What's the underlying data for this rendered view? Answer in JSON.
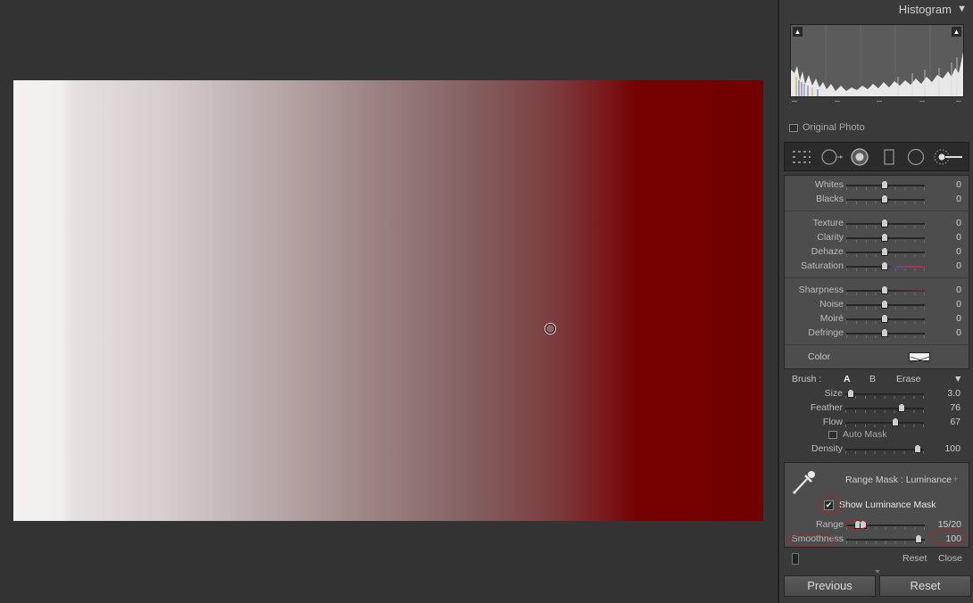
{
  "histogram": {
    "title": "Histogram",
    "toggle_icon": "triangle-down-icon",
    "original_photo_label": "Original Photo"
  },
  "tool_strip": {
    "icons": [
      "grid-overlay-icon",
      "crop-icon",
      "spot-removal-icon",
      "graduated-filter-icon",
      "radial-filter-icon",
      "adjustment-brush-icon"
    ]
  },
  "sliders": [
    {
      "label": "Whites",
      "value": "0",
      "level": 0.5
    },
    {
      "label": "Blacks",
      "value": "0",
      "level": 0.5
    },
    {
      "label": "Texture",
      "value": "0",
      "level": 0.5
    },
    {
      "label": "Clarity",
      "value": "0",
      "level": 0.5
    },
    {
      "label": "Dehaze",
      "value": "0",
      "level": 0.5
    },
    {
      "label": "Saturation",
      "value": "0",
      "level": 0.5
    },
    {
      "label": "Sharpness",
      "value": "0",
      "level": 0.5
    },
    {
      "label": "Noise",
      "value": "0",
      "level": 0.5
    },
    {
      "label": "Moiré",
      "value": "0",
      "level": 0.5
    },
    {
      "label": "Defringe",
      "value": "0",
      "level": 0.5
    }
  ],
  "color": {
    "label": "Color"
  },
  "brush": {
    "label": "Brush :",
    "a": "A",
    "b": "B",
    "erase": "Erase",
    "size": {
      "label": "Size",
      "value": "3.0",
      "level": 0.03
    },
    "feather": {
      "label": "Feather",
      "value": "76",
      "level": 0.76
    },
    "flow": {
      "label": "Flow",
      "value": "67",
      "level": 0.67
    },
    "auto_mask": "Auto Mask",
    "density": {
      "label": "Density",
      "value": "100",
      "level": 1.0
    }
  },
  "range_mask": {
    "label": "Range Mask : Luminance",
    "show_mask": "Show Luminance Mask",
    "show_mask_checked": true,
    "range": {
      "label": "Range",
      "value": "15/20"
    },
    "smoothness": {
      "label": "Smoothness",
      "value": "100",
      "level": 1.0
    }
  },
  "footer": {
    "reset": "Reset",
    "close": "Close"
  },
  "buttons": {
    "previous": "Previous",
    "reset": "Reset"
  },
  "colors": {
    "mask_red": "#730000",
    "panel_bg": "#3a3a3a",
    "canvas_bg": "#333333"
  }
}
